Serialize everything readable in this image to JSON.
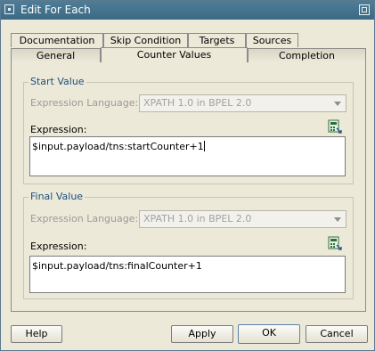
{
  "window": {
    "title": "Edit For Each"
  },
  "tabs_row1": [
    "Documentation",
    "Skip Condition",
    "Targets",
    "Sources"
  ],
  "tabs_row2": [
    "General",
    "Counter Values",
    "Completion"
  ],
  "active_tab": "Counter Values",
  "start_value": {
    "legend": "Start Value",
    "language_label": "Expression Language:",
    "language_value": "XPATH 1.0 in BPEL 2.0",
    "expression_label": "Expression:",
    "expression_value": "$input.payload/tns:startCounter+1"
  },
  "final_value": {
    "legend": "Final Value",
    "language_label": "Expression Language:",
    "language_value": "XPATH 1.0 in BPEL 2.0",
    "expression_label": "Expression:",
    "expression_value": "$input.payload/tns:finalCounter+1"
  },
  "buttons": {
    "help": "Help",
    "apply": "Apply",
    "ok": "OK",
    "cancel": "Cancel"
  },
  "colors": {
    "titlebar": "#3c6a84",
    "legend": "#1d4f82",
    "window_bg": "#ece9d8"
  },
  "icons": {
    "expression_builder": "calculator-icon",
    "window": "window-icon",
    "close": "close-icon"
  }
}
